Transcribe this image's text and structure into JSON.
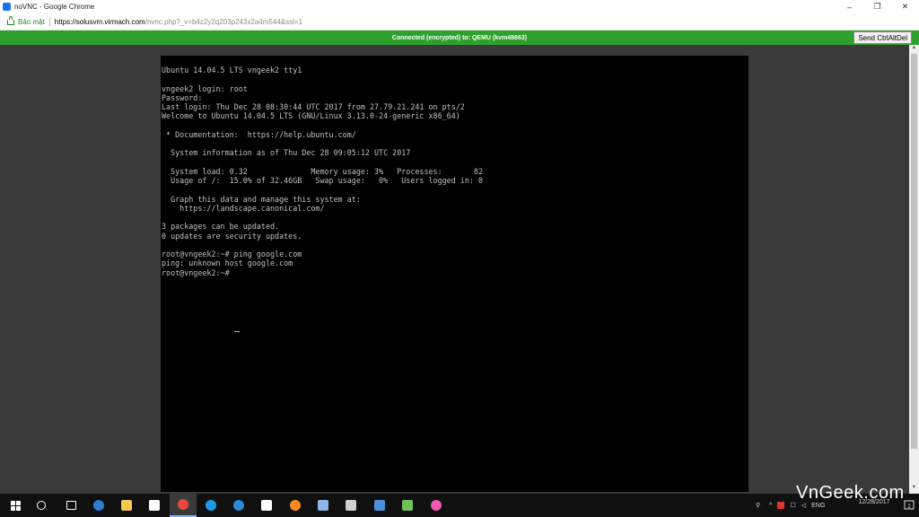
{
  "window": {
    "title": "noVNC - Google Chrome",
    "controls": {
      "minimize": "–",
      "maximize": "❐",
      "close": "✕"
    }
  },
  "address": {
    "secure_label": "Bảo mật",
    "url_host": "https://solusvm.virmach.com",
    "url_path": "/nvnc.php?_v=b4z2y2q203p243x2a4m544&ssl=1"
  },
  "vnc_status": {
    "text": "Connected (encrypted) to: QEMU (kvm48863)",
    "send_button": "Send CtrlAltDel"
  },
  "terminal": {
    "lines": [
      "Ubuntu 14.04.5 LTS vngeek2 tty1",
      "",
      "vngeek2 login: root",
      "Password:",
      "Last login: Thu Dec 28 08:30:44 UTC 2017 from 27.79.21.241 on pts/2",
      "Welcome to Ubuntu 14.04.5 LTS (GNU/Linux 3.13.0-24-generic x86_64)",
      "",
      " * Documentation:  https://help.ubuntu.com/",
      "",
      "  System information as of Thu Dec 28 09:05:12 UTC 2017",
      "",
      "  System load: 0.32              Memory usage: 3%   Processes:       82",
      "  Usage of /:  15.0% of 32.46GB   Swap usage:   0%   Users logged in: 0",
      "",
      "  Graph this data and manage this system at:",
      "    https://landscape.canonical.com/",
      "",
      "3 packages can be updated.",
      "0 updates are security updates.",
      "",
      "root@vngeek2:~# ping google.com",
      "ping: unknown host google.com",
      "root@vngeek2:~# "
    ]
  },
  "taskbar": {
    "items": [
      {
        "name": "start-button",
        "icon": "windows-logo-icon",
        "color": "#ffffff"
      },
      {
        "name": "search-button",
        "icon": "search-icon",
        "color": "#ffffff"
      },
      {
        "name": "task-view-button",
        "icon": "task-view-icon",
        "color": "#ffffff"
      },
      {
        "name": "edge-button",
        "icon": "edge-icon",
        "color": "#2f7bd1"
      },
      {
        "name": "file-explorer-button",
        "icon": "folder-icon",
        "color": "#f2c94c"
      },
      {
        "name": "mail-button",
        "icon": "mail-icon",
        "color": "#ffffff"
      },
      {
        "name": "chrome-button",
        "icon": "chrome-icon",
        "color": "#e9473b"
      },
      {
        "name": "app-c-button",
        "icon": "c-circle-icon",
        "color": "#1e9be8"
      },
      {
        "name": "wordpress-button",
        "icon": "wordpress-icon",
        "color": "#2b8bd6"
      },
      {
        "name": "store-button",
        "icon": "store-bag-icon",
        "color": "#ffffff"
      },
      {
        "name": "firefox-button",
        "icon": "firefox-icon",
        "color": "#ff8a1f"
      },
      {
        "name": "notepad-button",
        "icon": "notepad-icon",
        "color": "#8fb6e8"
      },
      {
        "name": "cmd-button",
        "icon": "terminal-icon",
        "color": "#cfcfcf"
      },
      {
        "name": "network-button",
        "icon": "network-icon",
        "color": "#4d8fdc"
      },
      {
        "name": "app-tools-button",
        "icon": "tools-icon",
        "color": "#6fc25a"
      },
      {
        "name": "itunes-button",
        "icon": "music-note-icon",
        "color": "#f25ab0"
      },
      {
        "name": "sublime-button",
        "icon": "sublime-icon",
        "color": "#f26b3a"
      }
    ],
    "tray": {
      "lang": "ENG",
      "time": "",
      "date": "12/28/2017"
    }
  },
  "watermark": "VnGeek.com"
}
